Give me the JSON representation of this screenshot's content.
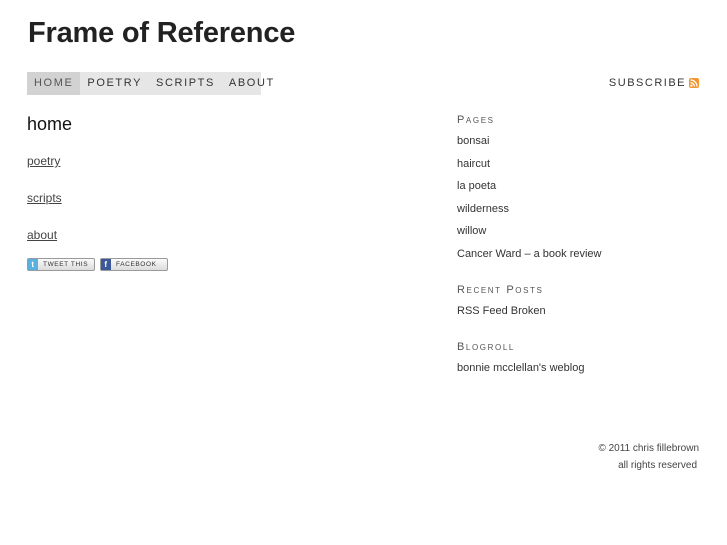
{
  "site": {
    "title": "Frame of Reference"
  },
  "nav": {
    "items": [
      {
        "label": "HOME",
        "active": true
      },
      {
        "label": "POETRY",
        "active": false
      },
      {
        "label": "SCRIPTS",
        "active": false
      },
      {
        "label": "ABOUT",
        "active": false
      }
    ],
    "subscribe_label": "SUBSCRIBE"
  },
  "main": {
    "heading": "home",
    "links": [
      "poetry",
      "scripts",
      "about"
    ],
    "share": {
      "tweet_label": "TWEET THIS",
      "facebook_label": "FACEBOOK"
    }
  },
  "sidebar": {
    "pages_title": "Pages",
    "pages": [
      "bonsai",
      "haircut",
      "la poeta",
      "wilderness",
      "willow",
      "Cancer Ward – a book review"
    ],
    "recent_title": "Recent Posts",
    "recent": [
      "RSS Feed Broken"
    ],
    "blogroll_title": "Blogroll",
    "blogroll": [
      "bonnie mcclellan's weblog"
    ]
  },
  "footer": {
    "copyright": "© 2011 chris fillebrown",
    "rights": "all rights reserved"
  },
  "colors": {
    "nav_bg": "#e6e6e6",
    "nav_active_bg": "#d2d2d2",
    "rss_orange": "#f29632",
    "twitter_blue": "#5ab0de",
    "facebook_blue": "#3b5998"
  },
  "icons": {
    "rss": "rss-icon",
    "twitter": "twitter-icon",
    "facebook": "facebook-icon"
  }
}
